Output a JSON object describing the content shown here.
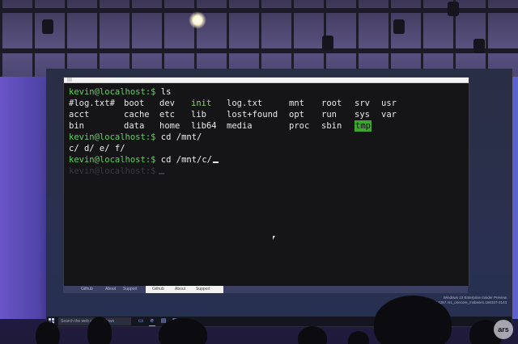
{
  "terminal": {
    "line1": {
      "prompt": "kevin@localhost:$",
      "command": " ls"
    },
    "ls_rows": [
      [
        "#log.txt#",
        "boot",
        "dev",
        "init",
        "log.txt",
        "mnt",
        "root",
        "srv",
        "usr"
      ],
      [
        "acct",
        "cache",
        "etc",
        "lib",
        "lost+found",
        "opt",
        "run",
        "sys",
        "var"
      ],
      [
        "bin",
        "data",
        "home",
        "lib64",
        "media",
        "proc",
        "sbin",
        "tmp",
        ""
      ]
    ],
    "highlighted_entry": "tmp",
    "line2": {
      "prompt": "kevin@localhost:$",
      "command": " cd /mnt/"
    },
    "output2": "c/ d/ e/ f/",
    "line3": {
      "prompt": "kevin@localhost:$",
      "command": " cd /mnt/c/"
    },
    "ghost_line": {
      "prompt": "kevin@localhost:$"
    }
  },
  "background_window": {
    "tabs_left": [
      "Github",
      "About",
      "Support"
    ],
    "tabs_right": [
      "Github",
      "About",
      "Support"
    ]
  },
  "taskbar": {
    "search_placeholder": "Search the web and Windows"
  },
  "watermark": {
    "line1": "Windows 10 Enterprise Insider Preview",
    "line2": "Evaluation copy. Build 14257.rs1_onecore_msbase1.160107-2143"
  },
  "corner_logo": "ars",
  "colors": {
    "prompt": "#5fd35f",
    "green_entry": "#7fe05a",
    "highlight_bg": "#3ea52e",
    "terminal_bg": "#151517"
  }
}
